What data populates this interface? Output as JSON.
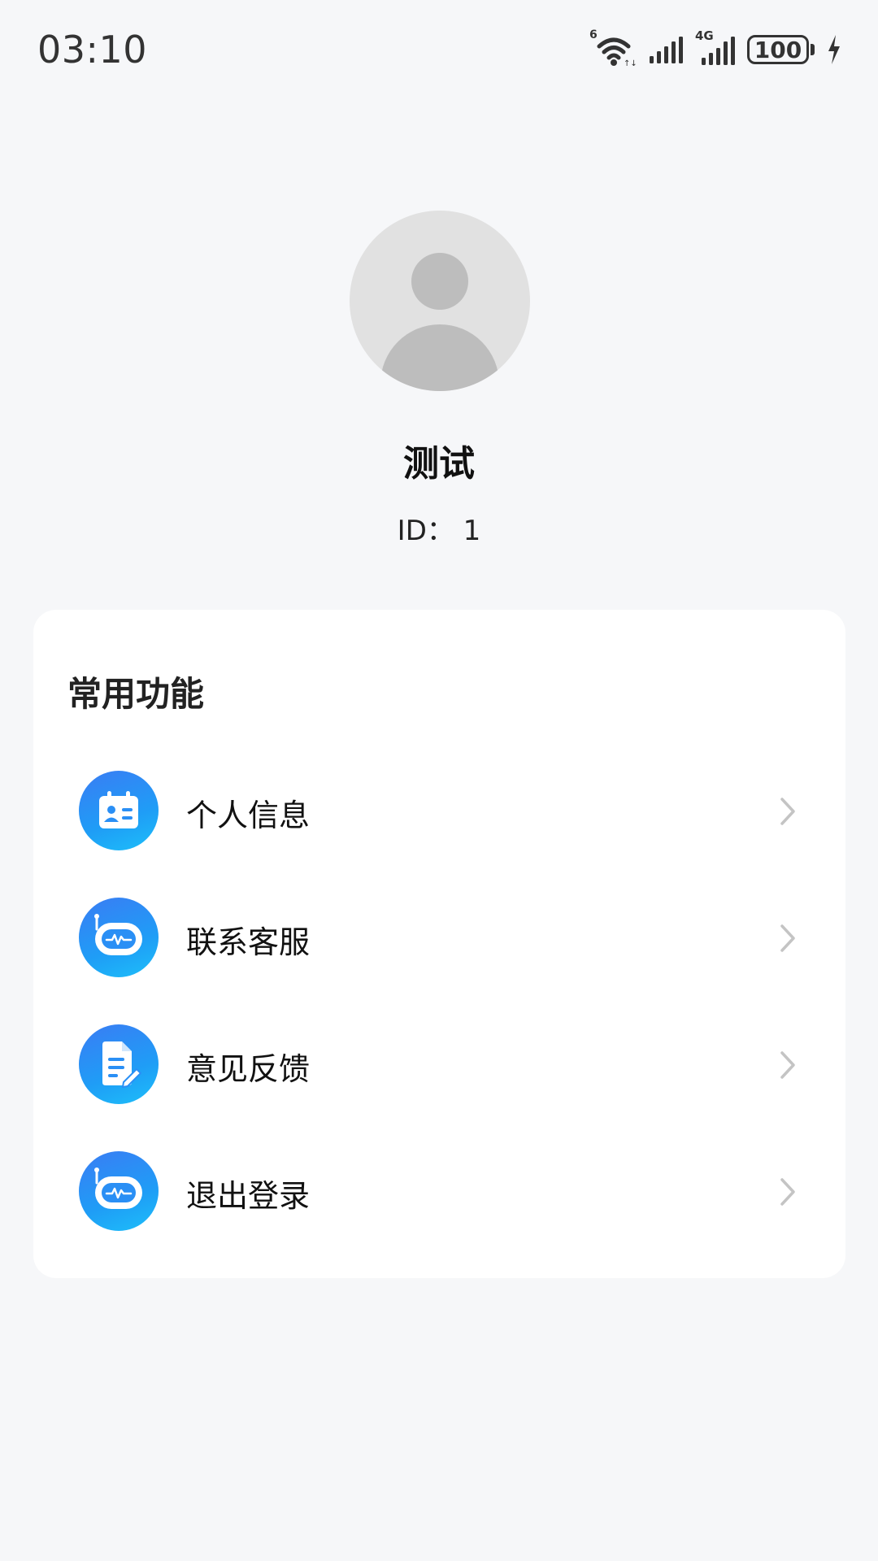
{
  "status_bar": {
    "time": "03:10",
    "wifi_badge": "6",
    "network_label": "4G",
    "battery_level": "100"
  },
  "profile": {
    "name": "测试",
    "id_text": "ID：  1"
  },
  "functions_card": {
    "title": "常用功能",
    "items": [
      {
        "label": "个人信息",
        "icon": "id-card-icon"
      },
      {
        "label": "联系客服",
        "icon": "robot-icon"
      },
      {
        "label": "意见反馈",
        "icon": "document-edit-icon"
      },
      {
        "label": "退出登录",
        "icon": "robot-icon"
      }
    ]
  },
  "colors": {
    "background": "#f6f7f9",
    "card": "#ffffff",
    "icon_gradient_start": "#3a7cf4",
    "icon_gradient_end": "#1dbff9",
    "chevron": "#c4c4c4"
  }
}
